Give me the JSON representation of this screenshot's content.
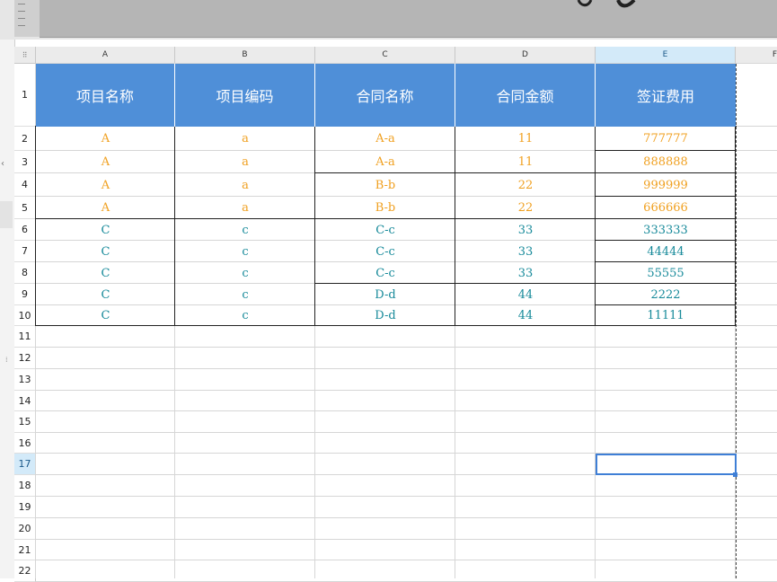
{
  "columns": [
    "A",
    "B",
    "C",
    "D",
    "E",
    "F"
  ],
  "active_column": "E",
  "header_row": {
    "number": "1",
    "cells": [
      "项目名称",
      "项目编码",
      "合同名称",
      "合同金额",
      "签证费用"
    ]
  },
  "rows": [
    {
      "number": "2",
      "cells": [
        "A",
        "a",
        "A-a",
        "11",
        "777777"
      ],
      "color": "orange"
    },
    {
      "number": "3",
      "cells": [
        "A",
        "a",
        "A-a",
        "11",
        "888888"
      ],
      "color": "orange"
    },
    {
      "number": "4",
      "cells": [
        "A",
        "a",
        "B-b",
        "22",
        "999999"
      ],
      "color": "orange"
    },
    {
      "number": "5",
      "cells": [
        "A",
        "a",
        "B-b",
        "22",
        "666666"
      ],
      "color": "orange"
    },
    {
      "number": "6",
      "cells": [
        "C",
        "c",
        "C-c",
        "33",
        "333333"
      ],
      "color": "teal"
    },
    {
      "number": "7",
      "cells": [
        "C",
        "c",
        "C-c",
        "33",
        "44444"
      ],
      "color": "teal"
    },
    {
      "number": "8",
      "cells": [
        "C",
        "c",
        "C-c",
        "33",
        "55555"
      ],
      "color": "teal"
    },
    {
      "number": "9",
      "cells": [
        "C",
        "c",
        "D-d",
        "44",
        "2222"
      ],
      "color": "teal"
    },
    {
      "number": "10",
      "cells": [
        "C",
        "c",
        "D-d",
        "44",
        "11111"
      ],
      "color": "teal"
    }
  ],
  "empty_rows": [
    "11",
    "12",
    "13",
    "14",
    "15",
    "16",
    "17",
    "18",
    "19",
    "20",
    "21",
    "22"
  ],
  "active_row": "17",
  "selected_cell": "E17",
  "colors": {
    "header_fill": "#4f8fd8",
    "orange_text": "#f0a020",
    "teal_text": "#178a9a",
    "selection": "#3f7fd6"
  }
}
